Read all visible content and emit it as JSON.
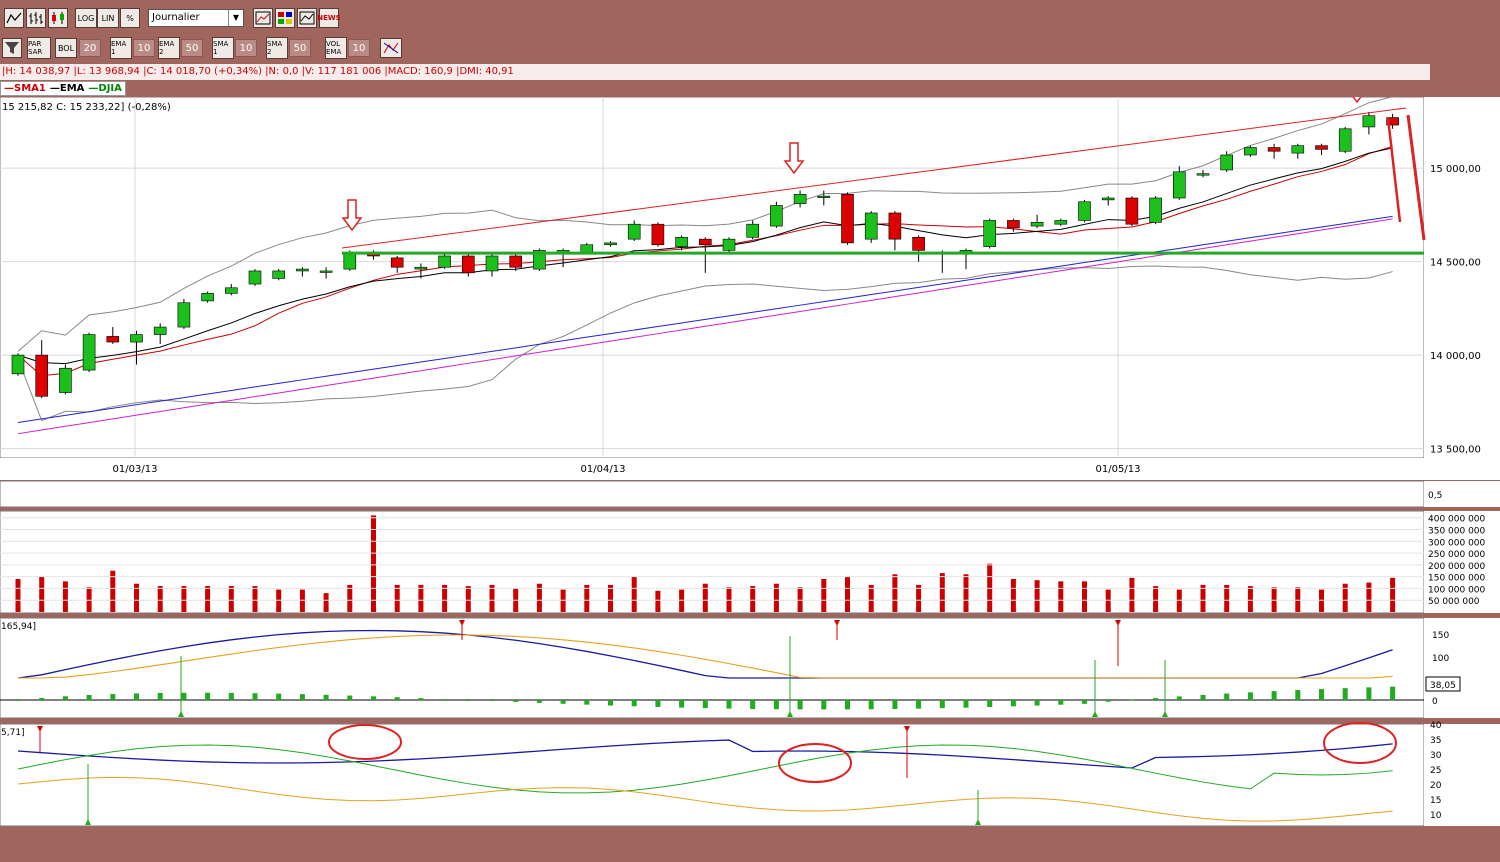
{
  "toolbar1": {
    "log_label": "LOG",
    "lin_label": "LIN",
    "pct_label": "%",
    "period_value": "Journalier",
    "news_label": "NEWS"
  },
  "toolbar2": {
    "par_sar_label": "PAR SAR",
    "bol_label": "BOL",
    "bol_value": "20",
    "ema1_label": "EMA 1",
    "ema1_value": "10",
    "ema2_label": "EMA 2",
    "ema2_value": "50",
    "sma1_label": "SMA 1",
    "sma1_value": "10",
    "sma2_label": "SMA 2",
    "sma2_value": "50",
    "volema_label": "VOL EMA",
    "volema_value": "10"
  },
  "info_line": "|H: 14 038,97 |L: 13 968,94 |C: 14 018,70 (+0,34%) |N: 0,0 |V: 117 181 006 |MACD: 160,9 |DMI: 40,91",
  "legend": [
    {
      "label": "SMA1",
      "color": "#cc0000"
    },
    {
      "label": "EMA",
      "color": "#000000"
    },
    {
      "label": "DJIA",
      "color": "#008800"
    }
  ],
  "price_readout": "15 215,82  C: 15 233,22] (-0,28%)",
  "macd_readout": "165,94]",
  "macd_value_box": "38,05",
  "dmi_readout": "5,71]",
  "colors": {
    "up": "#1cc01c",
    "down": "#dd0000",
    "support": "#22aa22",
    "annotation": "#dd2222"
  },
  "chart_data": [
    {
      "type": "candlestick",
      "title": "DJIA",
      "x_tick_labels": [
        "01/03/13",
        "01/04/13",
        "01/05/13"
      ],
      "y_ticks": [
        "13 500,00",
        "14 000,00",
        "14 500,00",
        "15 000,00"
      ],
      "ylim": [
        13450,
        15380
      ],
      "support_level": 14545,
      "candles": [
        {
          "o": 13900,
          "c": 14000,
          "h": 14010,
          "l": 13890
        },
        {
          "o": 14000,
          "c": 13780,
          "h": 14080,
          "l": 13770
        },
        {
          "o": 13800,
          "c": 13930,
          "h": 13950,
          "l": 13790
        },
        {
          "o": 13920,
          "c": 14110,
          "h": 14120,
          "l": 13910
        },
        {
          "o": 14100,
          "c": 14070,
          "h": 14150,
          "l": 14060
        },
        {
          "o": 14070,
          "c": 14110,
          "h": 14130,
          "l": 13950
        },
        {
          "o": 14110,
          "c": 14150,
          "h": 14170,
          "l": 14060
        },
        {
          "o": 14150,
          "c": 14280,
          "h": 14300,
          "l": 14140
        },
        {
          "o": 14290,
          "c": 14330,
          "h": 14340,
          "l": 14280
        },
        {
          "o": 14330,
          "c": 14360,
          "h": 14380,
          "l": 14320
        },
        {
          "o": 14380,
          "c": 14450,
          "h": 14460,
          "l": 14370
        },
        {
          "o": 14410,
          "c": 14450,
          "h": 14460,
          "l": 14400
        },
        {
          "o": 14450,
          "c": 14460,
          "h": 14470,
          "l": 14420
        },
        {
          "o": 14450,
          "c": 14450,
          "h": 14470,
          "l": 14410
        },
        {
          "o": 14460,
          "c": 14540,
          "h": 14560,
          "l": 14450
        },
        {
          "o": 14550,
          "c": 14530,
          "h": 14560,
          "l": 14510
        },
        {
          "o": 14520,
          "c": 14470,
          "h": 14530,
          "l": 14440
        },
        {
          "o": 14460,
          "c": 14470,
          "h": 14490,
          "l": 14410
        },
        {
          "o": 14470,
          "c": 14530,
          "h": 14540,
          "l": 14460
        },
        {
          "o": 14530,
          "c": 14440,
          "h": 14540,
          "l": 14420
        },
        {
          "o": 14450,
          "c": 14530,
          "h": 14550,
          "l": 14420
        },
        {
          "o": 14530,
          "c": 14470,
          "h": 14550,
          "l": 14450
        },
        {
          "o": 14460,
          "c": 14560,
          "h": 14570,
          "l": 14450
        },
        {
          "o": 14540,
          "c": 14560,
          "h": 14570,
          "l": 14470
        },
        {
          "o": 14550,
          "c": 14590,
          "h": 14600,
          "l": 14540
        },
        {
          "o": 14590,
          "c": 14600,
          "h": 14610,
          "l": 14580
        },
        {
          "o": 14620,
          "c": 14700,
          "h": 14720,
          "l": 14610
        },
        {
          "o": 14700,
          "c": 14590,
          "h": 14710,
          "l": 14580
        },
        {
          "o": 14580,
          "c": 14630,
          "h": 14640,
          "l": 14560
        },
        {
          "o": 14620,
          "c": 14590,
          "h": 14630,
          "l": 14440
        },
        {
          "o": 14560,
          "c": 14620,
          "h": 14630,
          "l": 14550
        },
        {
          "o": 14630,
          "c": 14700,
          "h": 14720,
          "l": 14620
        },
        {
          "o": 14690,
          "c": 14800,
          "h": 14820,
          "l": 14680
        },
        {
          "o": 14810,
          "c": 14860,
          "h": 14880,
          "l": 14790
        },
        {
          "o": 14850,
          "c": 14850,
          "h": 14880,
          "l": 14800
        },
        {
          "o": 14860,
          "c": 14600,
          "h": 14870,
          "l": 14590
        },
        {
          "o": 14620,
          "c": 14760,
          "h": 14770,
          "l": 14600
        },
        {
          "o": 14760,
          "c": 14620,
          "h": 14770,
          "l": 14560
        },
        {
          "o": 14630,
          "c": 14560,
          "h": 14640,
          "l": 14500
        },
        {
          "o": 14550,
          "c": 14540,
          "h": 14560,
          "l": 14440
        },
        {
          "o": 14540,
          "c": 14560,
          "h": 14570,
          "l": 14460
        },
        {
          "o": 14580,
          "c": 14720,
          "h": 14730,
          "l": 14570
        },
        {
          "o": 14720,
          "c": 14680,
          "h": 14730,
          "l": 14660
        },
        {
          "o": 14690,
          "c": 14710,
          "h": 14750,
          "l": 14680
        },
        {
          "o": 14700,
          "c": 14720,
          "h": 14730,
          "l": 14690
        },
        {
          "o": 14720,
          "c": 14820,
          "h": 14830,
          "l": 14710
        },
        {
          "o": 14830,
          "c": 14840,
          "h": 14850,
          "l": 14800
        },
        {
          "o": 14840,
          "c": 14700,
          "h": 14850,
          "l": 14690
        },
        {
          "o": 14710,
          "c": 14840,
          "h": 14850,
          "l": 14700
        },
        {
          "o": 14840,
          "c": 14980,
          "h": 15010,
          "l": 14830
        },
        {
          "o": 14970,
          "c": 14970,
          "h": 14990,
          "l": 14950
        },
        {
          "o": 14990,
          "c": 15070,
          "h": 15090,
          "l": 14980
        },
        {
          "o": 15070,
          "c": 15110,
          "h": 15120,
          "l": 15060
        },
        {
          "o": 15110,
          "c": 15090,
          "h": 15130,
          "l": 15050
        },
        {
          "o": 15080,
          "c": 15120,
          "h": 15130,
          "l": 15050
        },
        {
          "o": 15120,
          "c": 15100,
          "h": 15130,
          "l": 15070
        },
        {
          "o": 15090,
          "c": 15210,
          "h": 15220,
          "l": 15080
        },
        {
          "o": 15220,
          "c": 15280,
          "h": 15300,
          "l": 15180
        },
        {
          "o": 15270,
          "c": 15230,
          "h": 15290,
          "l": 15210
        }
      ],
      "volume_axis_labels": [
        "400 000 000",
        "350 000 000",
        "300 000 000",
        "250 000 000",
        "200 000 000",
        "150 000 000",
        "100 000 000",
        "50 000 000"
      ],
      "volume_ylim": [
        0,
        420000000
      ],
      "volume": [
        140,
        150,
        130,
        105,
        175,
        120,
        110,
        110,
        110,
        110,
        110,
        95,
        95,
        80,
        115,
        410,
        115,
        115,
        115,
        110,
        115,
        100,
        120,
        95,
        115,
        115,
        150,
        90,
        95,
        120,
        105,
        110,
        120,
        105,
        140,
        150,
        115,
        160,
        115,
        165,
        160,
        205,
        140,
        135,
        130,
        130,
        95,
        145,
        110,
        95,
        115,
        115,
        110,
        105,
        105,
        95,
        120,
        125,
        145
      ],
      "volume_unit": 1000000,
      "macd_axis_labels": [
        "150",
        "100",
        "0"
      ],
      "dmi_axis_labels": [
        "40",
        "35",
        "30",
        "25",
        "20",
        "15",
        "10"
      ],
      "pane1_axis_label": "0,5"
    }
  ]
}
